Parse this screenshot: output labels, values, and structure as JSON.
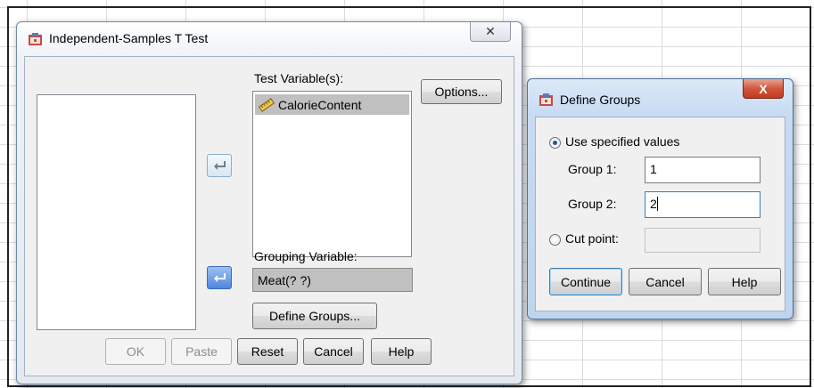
{
  "main_dialog": {
    "title": "Independent-Samples T Test",
    "close_glyph": "✕",
    "test_variables_label": "Test Variable(s):",
    "test_variables": [
      "CalorieContent"
    ],
    "options_label": "Options...",
    "grouping_label": "Grouping Variable:",
    "grouping_value": "Meat(? ?)",
    "define_groups_label": "Define Groups...",
    "buttons": {
      "ok": "OK",
      "paste": "Paste",
      "reset": "Reset",
      "cancel": "Cancel",
      "help": "Help"
    }
  },
  "define_dialog": {
    "title": "Define Groups",
    "close_glyph": "X",
    "use_specified": "Use specified values",
    "group1_label": "Group 1:",
    "group1_value": "1",
    "group2_label": "Group 2:",
    "group2_value": "2",
    "cut_point_label": "Cut point:",
    "cut_point_value": "",
    "buttons": {
      "continue": "Continue",
      "cancel": "Cancel",
      "help": "Help"
    }
  },
  "icons": {
    "app": "spss-dialog-icon",
    "variable": "ruler-scale-icon",
    "move": "move-arrow-icon"
  }
}
